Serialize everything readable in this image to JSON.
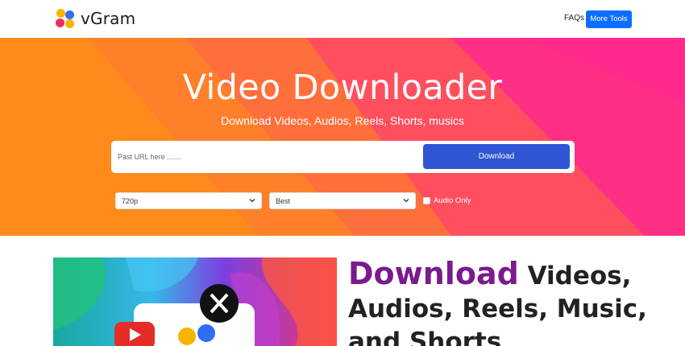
{
  "header": {
    "brand": "vGram",
    "logo_icon": "four-dots-logo-icon",
    "nav": {
      "faqs": "FAQs",
      "more_tools": "More Tools"
    }
  },
  "hero": {
    "title": "Video Downloader",
    "subtitle": "Download Videos, Audios, Reels, Shorts, musics",
    "url_placeholder": "Past URL here .......",
    "download_label": "Download",
    "quality_value": "720p",
    "format_value": "Best",
    "audio_only_label": "Audio Only",
    "audio_only_checked": false
  },
  "promo": {
    "heading_accent": "Download",
    "heading_rest": " Videos, Audios, Reels, Music, and Shorts",
    "image_icons": [
      "x-logo-icon",
      "youtube-play-icon",
      "dots-logo-icon"
    ]
  },
  "colors": {
    "accent_blue": "#0d6efd",
    "download_blue": "#2f55d4",
    "heading_purple": "#7b1a8f",
    "hero_orange": "#ff8a1c",
    "hero_pink": "#ff2f86"
  }
}
